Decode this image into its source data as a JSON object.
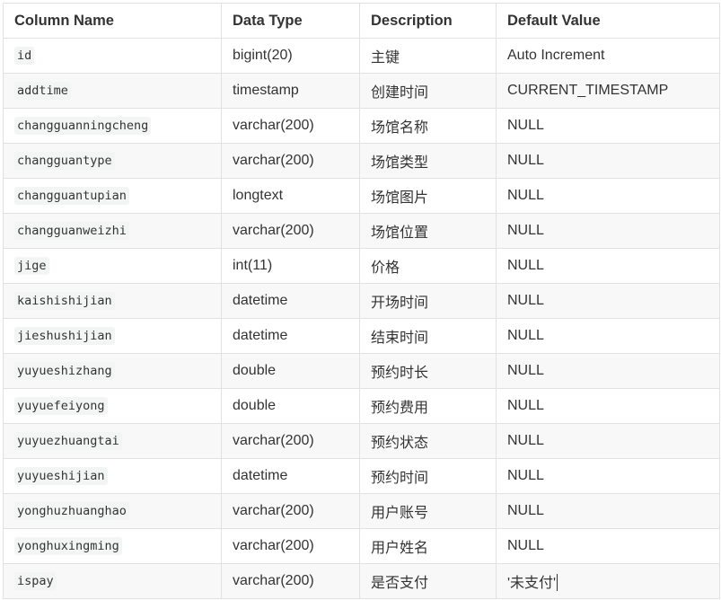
{
  "table": {
    "headers": [
      "Column Name",
      "Data Type",
      "Description",
      "Default Value"
    ],
    "rows": [
      {
        "name": "id",
        "type": "bigint(20)",
        "desc": "主键",
        "default": "Auto Increment"
      },
      {
        "name": "addtime",
        "type": "timestamp",
        "desc": "创建时间",
        "default": "CURRENT_TIMESTAMP"
      },
      {
        "name": "changguanningcheng",
        "type": "varchar(200)",
        "desc": "场馆名称",
        "default": "NULL"
      },
      {
        "name": "changguantype",
        "type": "varchar(200)",
        "desc": "场馆类型",
        "default": "NULL"
      },
      {
        "name": "changguantupian",
        "type": "longtext",
        "desc": "场馆图片",
        "default": "NULL"
      },
      {
        "name": "changguanweizhi",
        "type": "varchar(200)",
        "desc": "场馆位置",
        "default": "NULL"
      },
      {
        "name": "jige",
        "type": "int(11)",
        "desc": "价格",
        "default": "NULL"
      },
      {
        "name": "kaishishijian",
        "type": "datetime",
        "desc": "开场时间",
        "default": "NULL"
      },
      {
        "name": "jieshushijian",
        "type": "datetime",
        "desc": "结束时间",
        "default": "NULL"
      },
      {
        "name": "yuyueshizhang",
        "type": "double",
        "desc": "预约时长",
        "default": "NULL"
      },
      {
        "name": "yuyuefeiyong",
        "type": "double",
        "desc": "预约费用",
        "default": "NULL"
      },
      {
        "name": "yuyuezhuangtai",
        "type": "varchar(200)",
        "desc": "预约状态",
        "default": "NULL"
      },
      {
        "name": "yuyueshijian",
        "type": "datetime",
        "desc": "预约时间",
        "default": "NULL"
      },
      {
        "name": "yonghuzhuanghao",
        "type": "varchar(200)",
        "desc": "用户账号",
        "default": "NULL"
      },
      {
        "name": "yonghuxingming",
        "type": "varchar(200)",
        "desc": "用户姓名",
        "default": "NULL"
      },
      {
        "name": "ispay",
        "type": "varchar(200)",
        "desc": "是否支付",
        "default": "'未支付'"
      }
    ]
  },
  "colors": {
    "border": "#dfe2e5",
    "row_alt": "#f8f8f8",
    "code_bg": "#f3f4f4",
    "text": "#333333"
  }
}
